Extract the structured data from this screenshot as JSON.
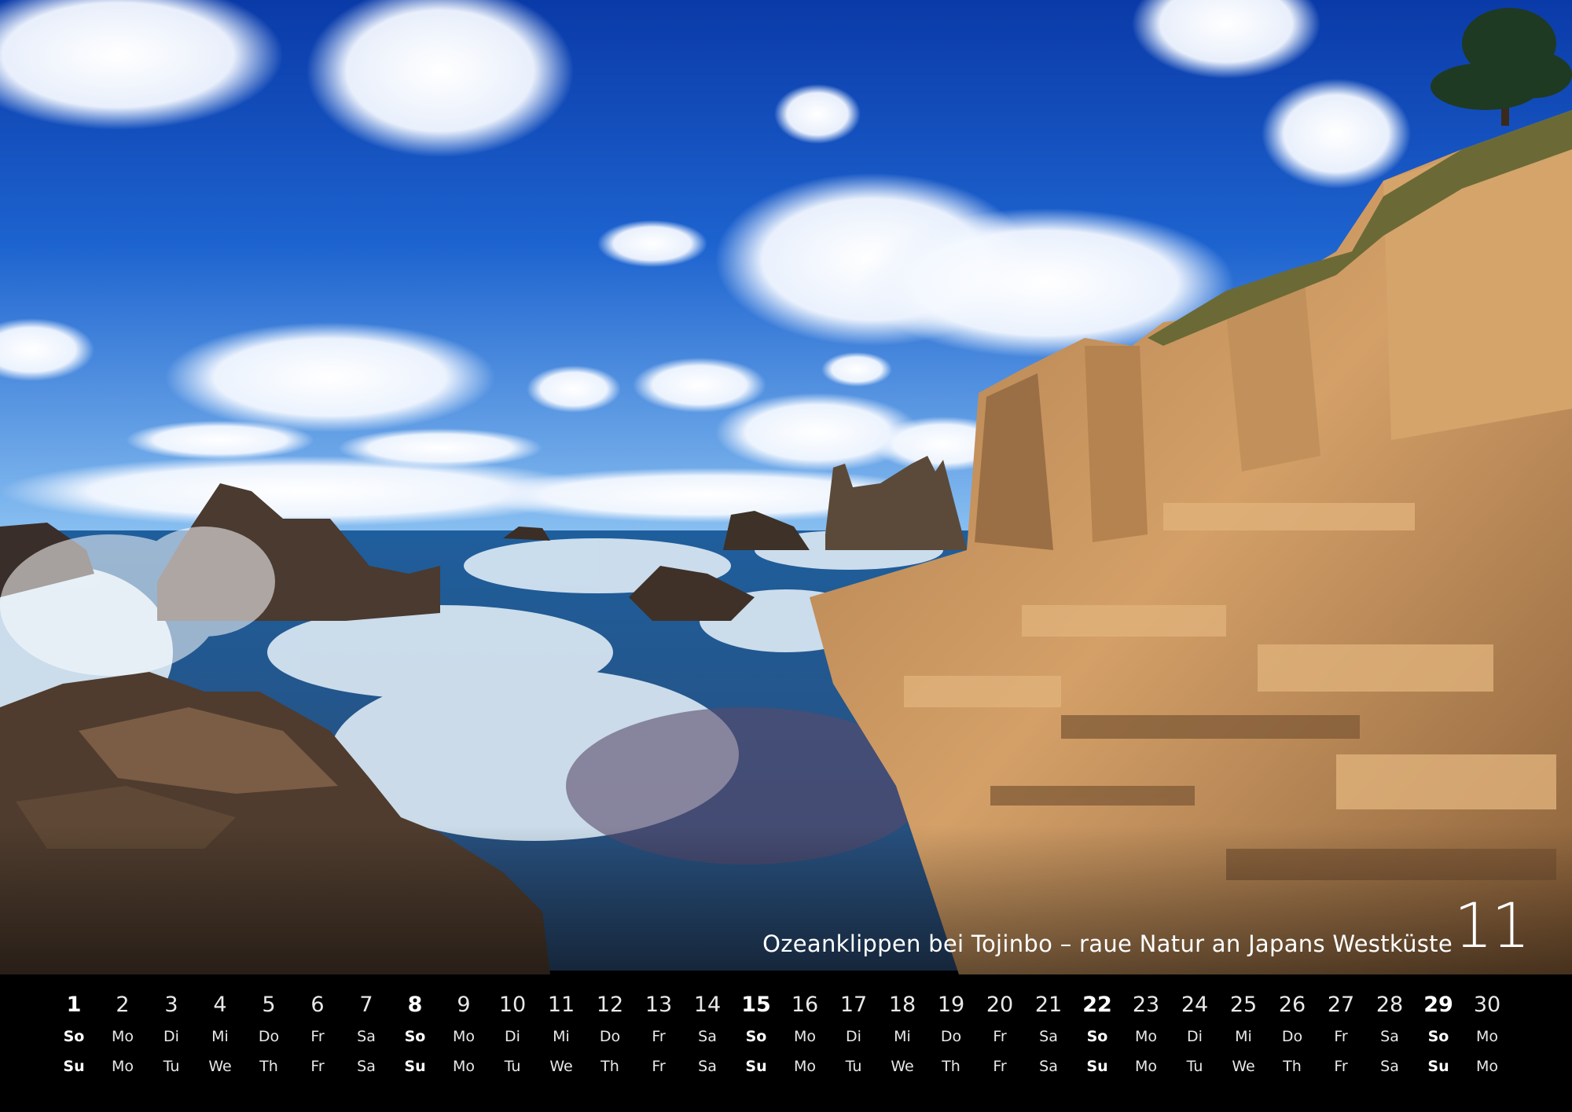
{
  "calendar": {
    "month_number": "11",
    "caption": "Ozeanklippen bei Tojinbo – raue Natur an Japans Westküste",
    "days": [
      "1",
      "2",
      "3",
      "4",
      "5",
      "6",
      "7",
      "8",
      "9",
      "10",
      "11",
      "12",
      "13",
      "14",
      "15",
      "16",
      "17",
      "18",
      "19",
      "20",
      "21",
      "22",
      "23",
      "24",
      "25",
      "26",
      "27",
      "28",
      "29",
      "30"
    ],
    "weekdays_de": [
      "So",
      "Mo",
      "Di",
      "Mi",
      "Do",
      "Fr",
      "Sa",
      "So",
      "Mo",
      "Di",
      "Mi",
      "Do",
      "Fr",
      "Sa",
      "So",
      "Mo",
      "Di",
      "Mi",
      "Do",
      "Fr",
      "Sa",
      "So",
      "Mo",
      "Di",
      "Mi",
      "Do",
      "Fr",
      "Sa",
      "So",
      "Mo"
    ],
    "weekdays_en": [
      "Su",
      "Mo",
      "Tu",
      "We",
      "Th",
      "Fr",
      "Sa",
      "Su",
      "Mo",
      "Tu",
      "We",
      "Th",
      "Fr",
      "Sa",
      "Su",
      "Mo",
      "Tu",
      "We",
      "Th",
      "Fr",
      "Sa",
      "Su",
      "Mo",
      "Tu",
      "We",
      "Th",
      "Fr",
      "Sa",
      "Su",
      "Mo"
    ],
    "sundays_bold": true
  },
  "colors": {
    "sky_top": "#0a3fae",
    "sky_bottom": "#6fb0ee",
    "cliff": "#c9935a",
    "sea": "#2f6fb0",
    "text": "#ffffff"
  }
}
